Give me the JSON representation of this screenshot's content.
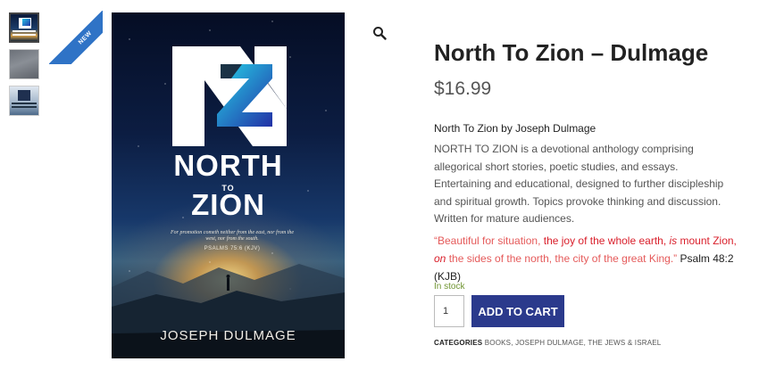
{
  "gallery": {
    "thumbnails": [
      {
        "name": "cover-front"
      },
      {
        "name": "cover-back"
      },
      {
        "name": "cover-alt"
      }
    ],
    "badge": "NEW"
  },
  "cover": {
    "title_line1": "NORTH",
    "title_line2": "TO",
    "title_line3": "ZION",
    "verse": "For promotion cometh neither from the east, nor from the west, nor from the south.",
    "verse_ref": "PSALMS 75:6 (KJV)",
    "author": "JOSEPH DULMAGE"
  },
  "product": {
    "title": "North To Zion – Dulmage",
    "price": "$16.99",
    "description_heading": "North To Zion by Joseph Dulmage",
    "description": "NORTH TO ZION is a devotional anthology comprising allegorical short stories, poetic studies, and essays. Entertaining and educational, designed to further discipleship and spiritual growth. Topics provoke thinking and discussion. Written for mature audiences.",
    "quote": {
      "part1": "“Beautiful for situation, ",
      "part2": "the joy of the whole earth, ",
      "part3": "is",
      "part4": " mount Zion, ",
      "part5": "on",
      "part6": " the sides of the north, the city of the great King.”",
      "ref": " Psalm 48:2 (KJB)"
    },
    "stock": "In stock",
    "quantity": "1",
    "add_to_cart": "ADD TO CART",
    "categories_label": "CATEGORIES",
    "categories": [
      "BOOKS",
      "JOSEPH DULMAGE",
      "THE JEWS & ISRAEL"
    ]
  },
  "icons": {
    "zoom": "magnifier-icon"
  },
  "colors": {
    "button": "#2b3a8c",
    "stock": "#6f9431",
    "quote_red": "#d91e2a",
    "ribbon": "#2f73c6"
  }
}
